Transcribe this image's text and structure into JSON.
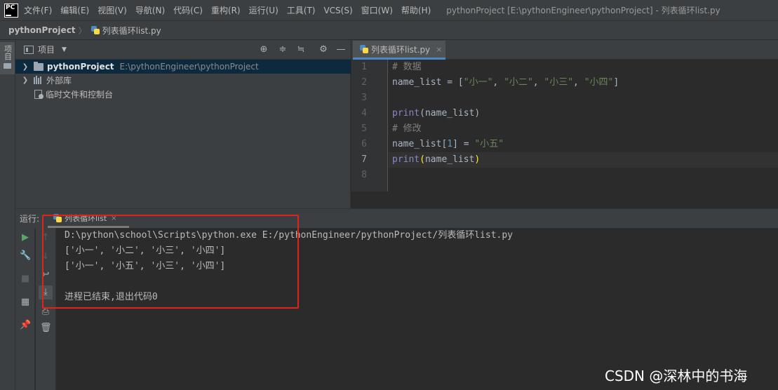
{
  "menubar": {
    "logo_text": "PC",
    "items": [
      "文件(F)",
      "编辑(E)",
      "视图(V)",
      "导航(N)",
      "代码(C)",
      "重构(R)",
      "运行(U)",
      "工具(T)",
      "VCS(S)",
      "窗口(W)",
      "帮助(H)"
    ],
    "window_title": "pythonProject [E:\\pythonEngineer\\pythonProject] - 列表循环list.py"
  },
  "breadcrumb": {
    "project": "pythonProject",
    "file": "列表循环list.py"
  },
  "left_strip": {
    "project_tab": "项目"
  },
  "project_panel": {
    "title": "项目",
    "tree": {
      "project_name": "pythonProject",
      "project_path": "E:\\pythonEngineer\\pythonProject",
      "external_libraries": "外部库",
      "scratches": "临时文件和控制台"
    }
  },
  "editor": {
    "tab_label": "列表循环list.py",
    "line_numbers": [
      "1",
      "2",
      "3",
      "4",
      "5",
      "6",
      "7",
      "8"
    ],
    "active_line": 7,
    "code": {
      "l1_comment": "# 数据",
      "l2_var": "name_list = [",
      "l2_s1": "\"小一\"",
      "l2_s2": "\"小二\"",
      "l2_s3": "\"小三\"",
      "l2_s4": "\"小四\"",
      "l4_fn": "print",
      "l4_args": "(name_list)",
      "l5_comment": "# 修改",
      "l6_var": "name_list[",
      "l6_index": "1",
      "l6_mid": "] = ",
      "l6_str": "\"小五\"",
      "l7_fn": "print",
      "l7_open": "(",
      "l7_arg": "name_list",
      "l7_close": ")"
    }
  },
  "run_panel": {
    "label": "运行:",
    "tab_label": "列表循环list",
    "console": [
      "D:\\python\\school\\Scripts\\python.exe E:/pythonEngineer/pythonProject/列表循环list.py",
      "['小一', '小二', '小三', '小四']",
      "['小一', '小五', '小三', '小四']",
      "",
      "进程已结束,退出代码0"
    ]
  },
  "watermark": "CSDN @深林中的书海",
  "colors": {
    "highlight_box": "#e0241c",
    "run_green": "#59a869",
    "active_tab_underline": "#4a88c7"
  }
}
